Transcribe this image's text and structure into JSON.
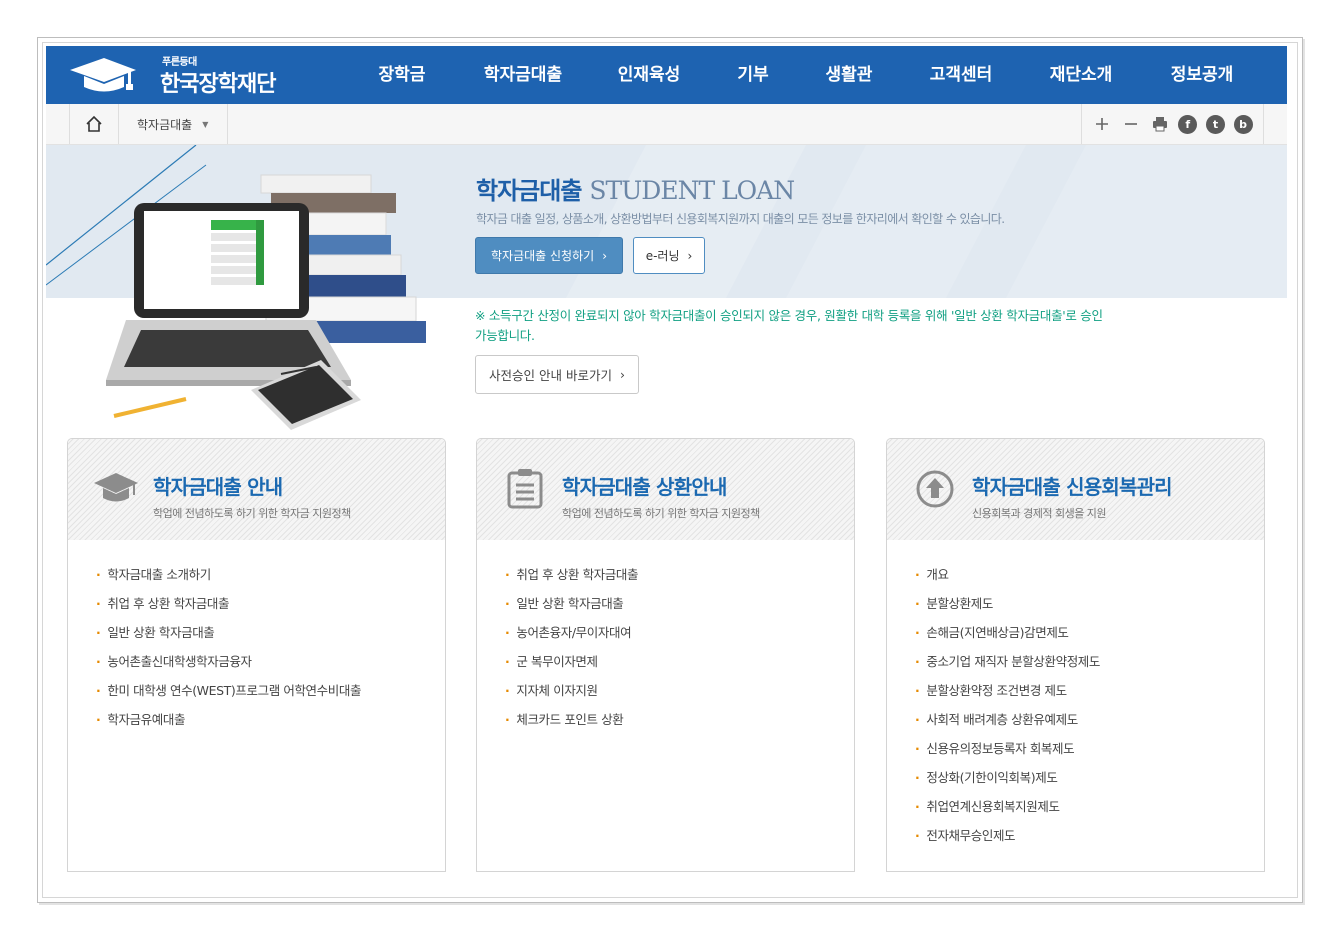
{
  "header": {
    "logo_small": "푸른등대",
    "logo_main": "한국장학재단",
    "nav": [
      "장학금",
      "학자금대출",
      "인재육성",
      "기부",
      "생활관",
      "고객센터",
      "재단소개",
      "정보공개"
    ]
  },
  "utility": {
    "breadcrumb": "학자금대출",
    "sns": [
      "f",
      "t",
      "b"
    ]
  },
  "visual": {
    "title_ko": "학자금대출",
    "title_en": "STUDENT LOAN",
    "description": "학자금 대출 일정, 상품소개, 상환방법부터 신용회복지원까지 대출의 모든 정보를 한자리에서 확인할 수 있습니다.",
    "apply_button": "학자금대출 신청하기",
    "elearning_button": "e-러닝",
    "notice_line1": "※ 소득구간 산정이 완료되지 않아 학자금대출이 승인되지 않은 경우, 원활한 대학 등록을 위해 '일반 상환 학자금대출'로 승인",
    "notice_line2": "가능합니다.",
    "pre_approval_button": "사전승인 안내 바로가기"
  },
  "cards": [
    {
      "title": "학자금대출 안내",
      "subtitle": "학업에 전념하도록 하기 위한 학자금 지원정책",
      "items": [
        "학자금대출 소개하기",
        "취업 후 상환 학자금대출",
        "일반 상환 학자금대출",
        "농어촌출신대학생학자금융자",
        "한미 대학생 연수(WEST)프로그램 어학연수비대출",
        "학자금유예대출"
      ]
    },
    {
      "title": "학자금대출 상환안내",
      "subtitle": "학업에 전념하도록 하기 위한 학자금 지원정책",
      "items": [
        "취업 후 상환 학자금대출",
        "일반 상환 학자금대출",
        "농어촌융자/무이자대여",
        "군 복무이자면제",
        "지자체 이자지원",
        "체크카드 포인트 상환"
      ]
    },
    {
      "title": "학자금대출 신용회복관리",
      "subtitle": "신용회복과 경제적 회생을 지원",
      "items": [
        "개요",
        "분할상환제도",
        "손해금(지연배상금)감면제도",
        "중소기업 재직자 분할상환약정제도",
        "분할상환약정 조건변경 제도",
        "사회적 배려계층 상환유예제도",
        "신용유의정보등록자 회복제도",
        "정상화(기한이익회복)제도",
        "취업연계신용회복지원제도",
        "전자채무승인제도"
      ]
    }
  ],
  "colors": {
    "header_blue": "#1e63b1",
    "title_blue": "#1b69b1",
    "notice_green": "#12a083",
    "apply_button": "#4f8dc1"
  }
}
